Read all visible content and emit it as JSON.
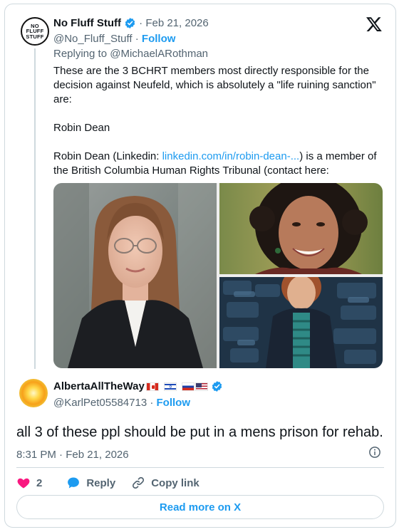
{
  "quoted_tweet": {
    "avatar_text": [
      "NO",
      "FLUFF",
      "STUFF"
    ],
    "author_name": "No Fluff Stuff",
    "date": "Feb 21, 2026",
    "handle": "@No_Fluff_Stuff",
    "follow_label": "Follow",
    "replying_to_prefix": "Replying to ",
    "replying_to_handle": "@MichaelARothman",
    "text_lines": [
      "These are the 3 BCHRT members most directly responsible for the decision against Neufeld, which is absolutely a \"life ruining sanction\" are:",
      "Robin Dean"
    ],
    "text_last_prefix": "Robin Dean (Linkedin: ",
    "text_last_link": "linkedin.com/in/robin-dean-...",
    "text_last_suffix": ") is a member of the British Columbia Human Rights Tribunal (contact here:"
  },
  "main_tweet": {
    "author_name": "AlbertaAllTheWay",
    "flags": [
      "canada-flag-icon",
      "israel-flag-icon",
      "russia-flag-icon",
      "usa-flag-icon"
    ],
    "handle": "@KarlPet05584713",
    "follow_label": "Follow",
    "text": "all 3 of these ppl should be put in a mens prison for rehab.",
    "timestamp": "8:31 PM · Feb 21, 2026",
    "like_count": "2",
    "reply_label": "Reply",
    "copy_link_label": "Copy link",
    "read_more_label": "Read more on X"
  },
  "colors": {
    "accent": "#1d9bf0",
    "muted": "#536471",
    "like": "#f91880",
    "border": "#cfd9de"
  }
}
